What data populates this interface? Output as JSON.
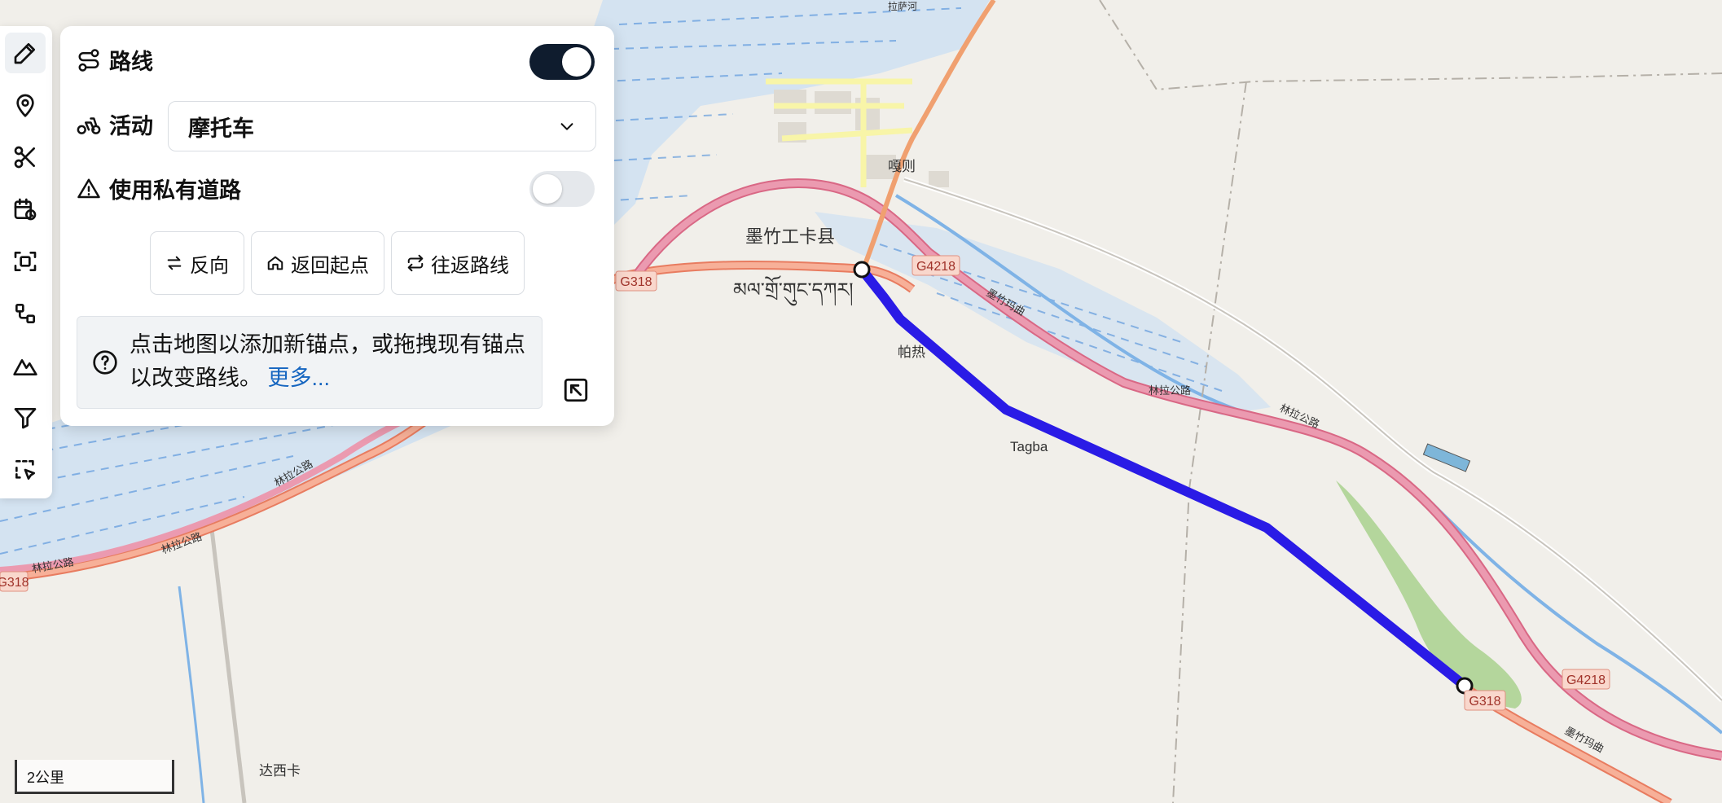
{
  "toolbar": {
    "tools": [
      "pencil-icon",
      "map-pin-icon",
      "scissors-icon",
      "calendar-clock-icon",
      "scan-icon",
      "route-nodes-icon",
      "mountain-icon",
      "filter-icon",
      "select-icon"
    ]
  },
  "panel": {
    "route_label": "路线",
    "route_toggle": true,
    "activity_label": "活动",
    "activity_value": "摩托车",
    "private_roads_label": "使用私有道路",
    "private_roads_toggle": false,
    "buttons": {
      "reverse": "反向",
      "back_to_start": "返回起点",
      "round_trip": "往返路线"
    },
    "help_text": "点击地图以添加新锚点，或拖拽现有锚点以改变路线。",
    "help_more": "更多..."
  },
  "map": {
    "place_labels": [
      "墨竹工卡县",
      "མལ་གྲོ་གུང་དཀར།",
      "嘎则",
      "帕热",
      "Tagba",
      "达西卡"
    ],
    "road_shields": [
      "G318",
      "G4218",
      "G318",
      "G4218",
      "G318"
    ],
    "road_names": [
      "林拉公路",
      "墨竹玛曲",
      "拉萨河"
    ],
    "colors": {
      "route": "#2a1be6",
      "water": "#a8ccf0",
      "motorway": "#e6899e",
      "trunk": "#f4a98c",
      "land": "#f2efe9"
    }
  },
  "scale_label": "2公里"
}
